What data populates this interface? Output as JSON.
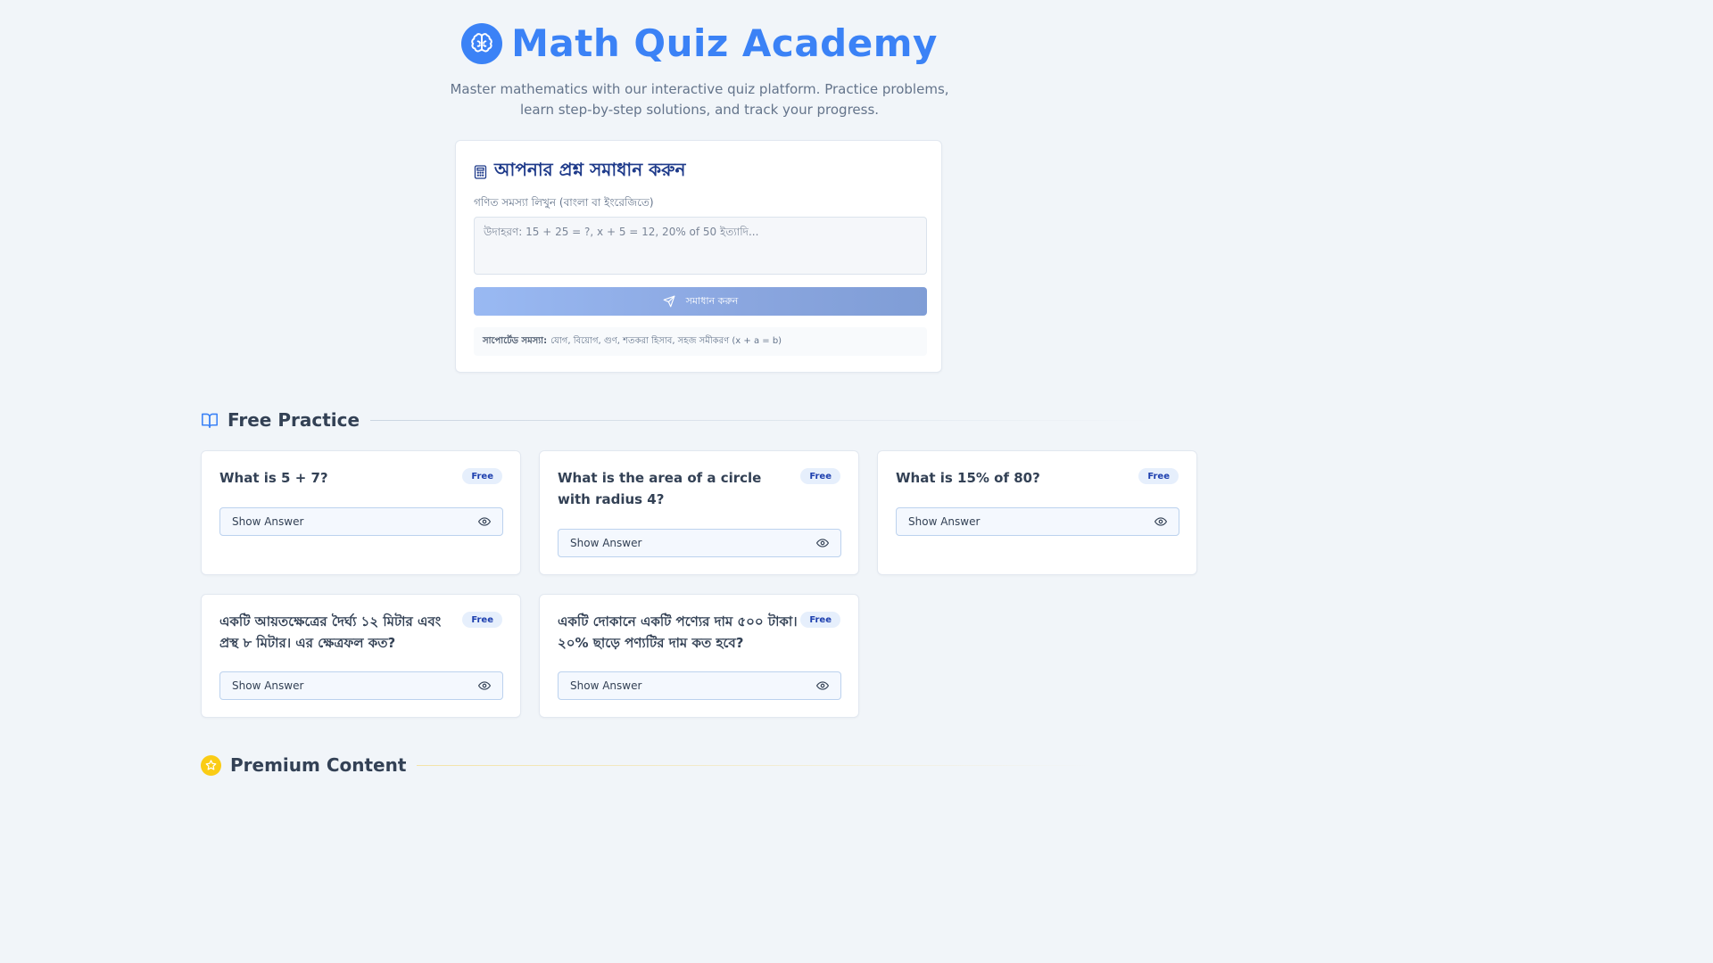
{
  "header": {
    "brand_icon": "brain-icon",
    "title": "Math Quiz Academy",
    "subtitle": "Master mathematics with our interactive quiz platform. Practice problems, learn step-by-step solutions, and track your progress."
  },
  "solver": {
    "icon": "calculator-icon",
    "title": "আপনার প্রশ্ন সমাধান করুন",
    "input_label": "গণিত সমস্যা লিখুন (বাংলা বা ইংরেজিতে)",
    "input_value": "",
    "input_placeholder": "উদাহরণ: 15 + 25 = ?, x + 5 = 12, 20% of 50 ইত্যাদি...",
    "button_icon": "send-icon",
    "button_label": "সমাধান করুন",
    "supported_label": "সাপোর্টেড সমস্যা:",
    "supported_text": "যোগ, বিয়োগ, গুণ, শতকরা হিসাব, সহজ সমীকরণ (x + a = b)"
  },
  "free_section": {
    "icon": "open-book-icon",
    "title": "Free Practice",
    "show_answer_label": "Show Answer",
    "show_answer_icon": "eye-icon",
    "questions": [
      {
        "text": "What is 5 + 7?",
        "badge": "Free"
      },
      {
        "text": "What is the area of a circle with radius 4?",
        "badge": "Free"
      },
      {
        "text": "What is 15% of 80?",
        "badge": "Free"
      },
      {
        "text": "একটি আয়তক্ষেত্রের দৈর্ঘ্য ১২ মিটার এবং প্রস্থ ৮ মিটার। এর ক্ষেত্রফল কত?",
        "badge": "Free"
      },
      {
        "text": "একটি দোকানে একটি পণ্যের দাম ৫০০ টাকা। ২০% ছাড়ে পণ্যটির দাম কত হবে?",
        "badge": "Free"
      }
    ]
  },
  "premium_section": {
    "icon": "star-icon",
    "title": "Premium Content"
  },
  "colors": {
    "primary": "#3b82f6",
    "heading_dark": "#1e3a8a",
    "badge_bg": "#e6effc",
    "premium_accent": "#facc15"
  }
}
